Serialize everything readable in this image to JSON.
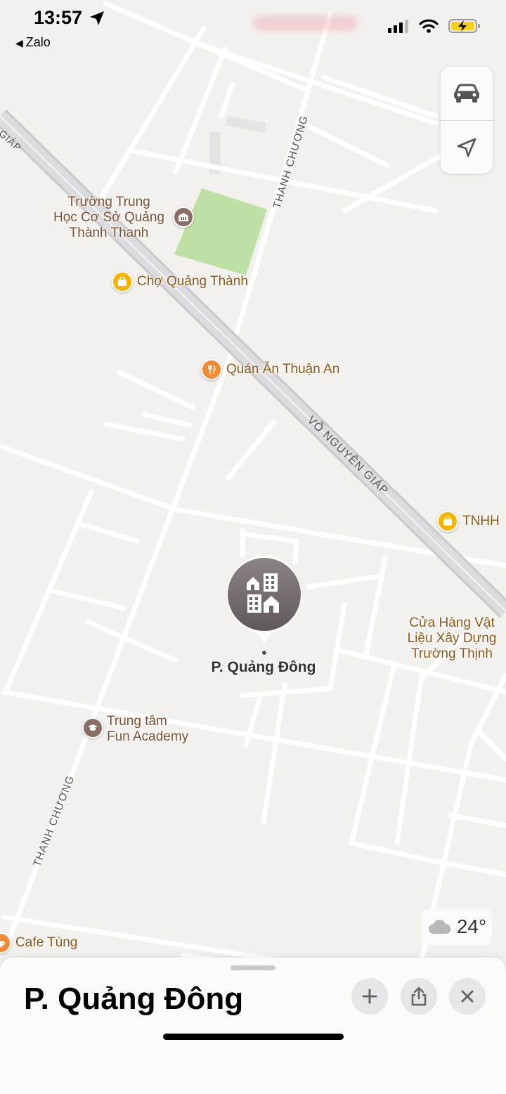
{
  "status_bar": {
    "time": "13:57",
    "back_app": "Zalo"
  },
  "map_controls": {
    "drive_icon": "car-icon",
    "locate_icon": "location-arrow-icon"
  },
  "roads": {
    "thanh_chuong_top": "THANH CHƯƠNG",
    "vo_nguyen_giap": "VÕ NGUYÊN GIÁP",
    "thanh_chuong_bottom": "THANH CHƯƠNG",
    "giap_partial": "GIÁP"
  },
  "pois": {
    "school": "Trường Trung Học Cơ Sở Quảng Thành Thanh",
    "school_lines": [
      "Trường Trung",
      "Học Cơ Sở Quảng",
      "Thành Thanh"
    ],
    "market": "Chợ Quảng Thành",
    "restaurant": "Quán Ăn Thuận An",
    "company": "TNHH",
    "store_lines": [
      "Cửa Hàng Vật",
      "Liệu Xây Dựng",
      "Trường Thịnh"
    ],
    "academy_lines": [
      "Trung tâm",
      "Fun Academy"
    ],
    "cafe": "Cafe Tùng"
  },
  "place_pin": {
    "label": "P. Quảng Đông"
  },
  "weather": {
    "temperature": "24°"
  },
  "sheet": {
    "title": "P. Quảng Đông"
  }
}
